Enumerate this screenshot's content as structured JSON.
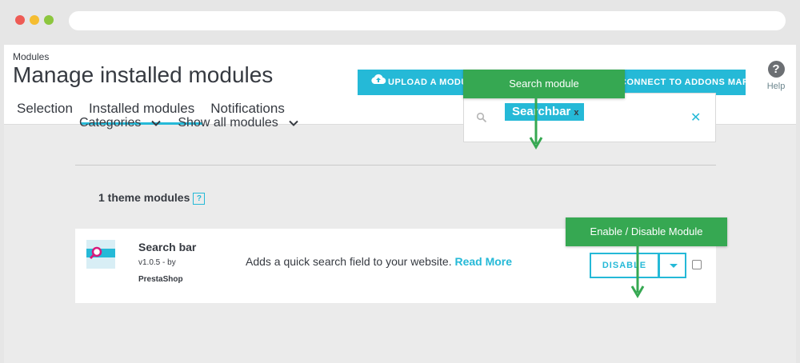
{
  "header": {
    "breadcrumb": "Modules",
    "title": "Manage installed modules",
    "tabs": [
      {
        "label": "Selection"
      },
      {
        "label": "Installed modules",
        "active": true
      },
      {
        "label": "Notifications"
      }
    ],
    "upload_button": "UPLOAD A MODULE",
    "marketplace_button": "CONNECT TO ADDONS MARKETPLACE",
    "help_label": "Help"
  },
  "filters": {
    "categories": "Categories",
    "show_all": "Show all modules"
  },
  "search": {
    "tag": "Searchbar",
    "tag_remove": "x",
    "clear": "✕"
  },
  "section": {
    "title": "1 theme modules",
    "help_glyph": "?"
  },
  "module": {
    "name": "Search bar",
    "version": "v1.0.5 - by",
    "author": "PrestaShop",
    "description": "Adds a quick search field to your website.",
    "read_more": "Read More",
    "disable_label": "DISABLE",
    "checked": false
  },
  "callouts": {
    "search": "Search module",
    "enable": "Enable / Disable Module"
  },
  "colors": {
    "accent": "#25b9d7",
    "callout": "#36a852",
    "text": "#363a41"
  },
  "icons": {
    "upload": "cloud-upload-icon",
    "help": "help-circle-icon",
    "search": "search-icon",
    "dropdown": "chevron-down-icon",
    "module_logo": "search-module-logo"
  }
}
